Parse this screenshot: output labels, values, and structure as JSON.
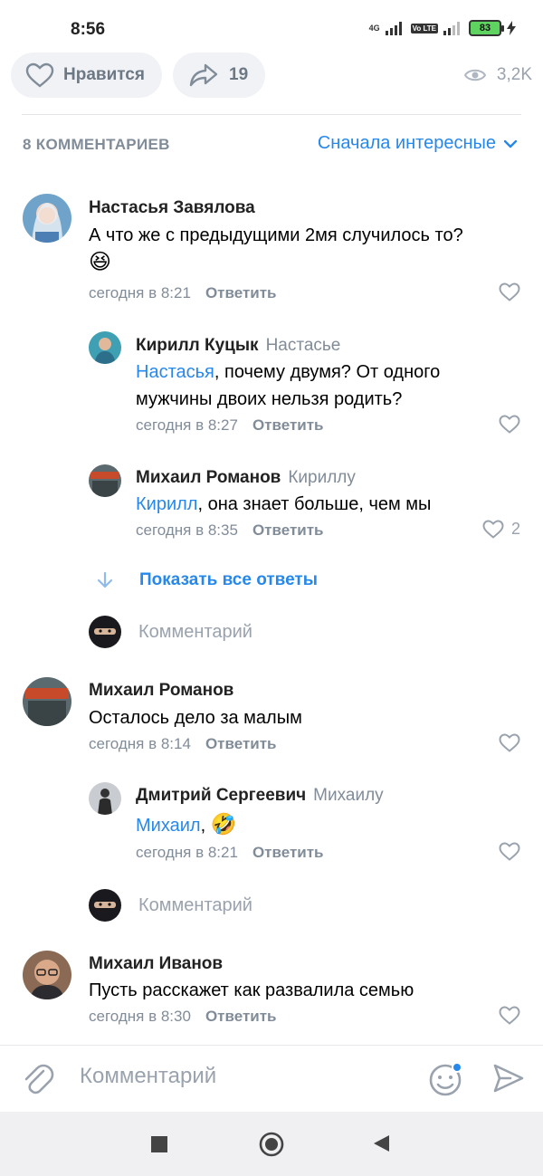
{
  "status_bar": {
    "time": "8:56",
    "network": "4G",
    "volte": "Vo LTE",
    "battery": "83"
  },
  "actions": {
    "like_label": "Нравится",
    "share_count": "19",
    "views": "3,2K"
  },
  "comments_header": {
    "count_label": "8 КОММЕНТАРИЕВ",
    "sort_label": "Сначала интересные"
  },
  "comments": [
    {
      "author": "Настасья Завялова",
      "text": "А что же с предыдущими 2мя случилось то?",
      "emoji": "😆",
      "time": "сегодня в 8:21",
      "reply_label": "Ответить",
      "likes": ""
    },
    {
      "author": "Кирилл Куцык",
      "reply_to": "Настасье",
      "mention": "Настасья",
      "text": ", почему двумя? От одного мужчины двоих нельзя родить?",
      "time": "сегодня в 8:27",
      "reply_label": "Ответить",
      "likes": ""
    },
    {
      "author": "Михаил Романов",
      "reply_to": "Кириллу",
      "mention": "Кирилл",
      "text": ", она знает больше, чем мы",
      "time": "сегодня в 8:35",
      "reply_label": "Ответить",
      "likes": "2"
    },
    {
      "author": "Михаил Романов",
      "text": "Осталось дело за малым",
      "time": "сегодня в 8:14",
      "reply_label": "Ответить",
      "likes": ""
    },
    {
      "author": "Дмитрий Сергеевич",
      "reply_to": "Михаилу",
      "mention": "Михаил",
      "text": ", ",
      "emoji": "🤣",
      "time": "сегодня в 8:21",
      "reply_label": "Ответить",
      "likes": ""
    },
    {
      "author": "Михаил Иванов",
      "text": "Пусть расскажет как развалила семью",
      "time": "сегодня в 8:30",
      "reply_label": "Ответить",
      "likes": ""
    }
  ],
  "show_all_replies": "Показать все ответы",
  "inline_composer_placeholder": "Комментарий",
  "bottom_composer": {
    "placeholder": "Комментарий"
  },
  "colors": {
    "accent": "#2688eb",
    "secondary_text": "#818c99",
    "pill_bg": "#f0f2f5"
  },
  "icons": [
    "heart-icon",
    "share-icon",
    "eye-icon",
    "chevron-down-icon",
    "arrow-down-icon",
    "paperclip-icon",
    "smile-icon",
    "send-icon",
    "nav-square-icon",
    "nav-circle-icon",
    "nav-back-icon"
  ]
}
